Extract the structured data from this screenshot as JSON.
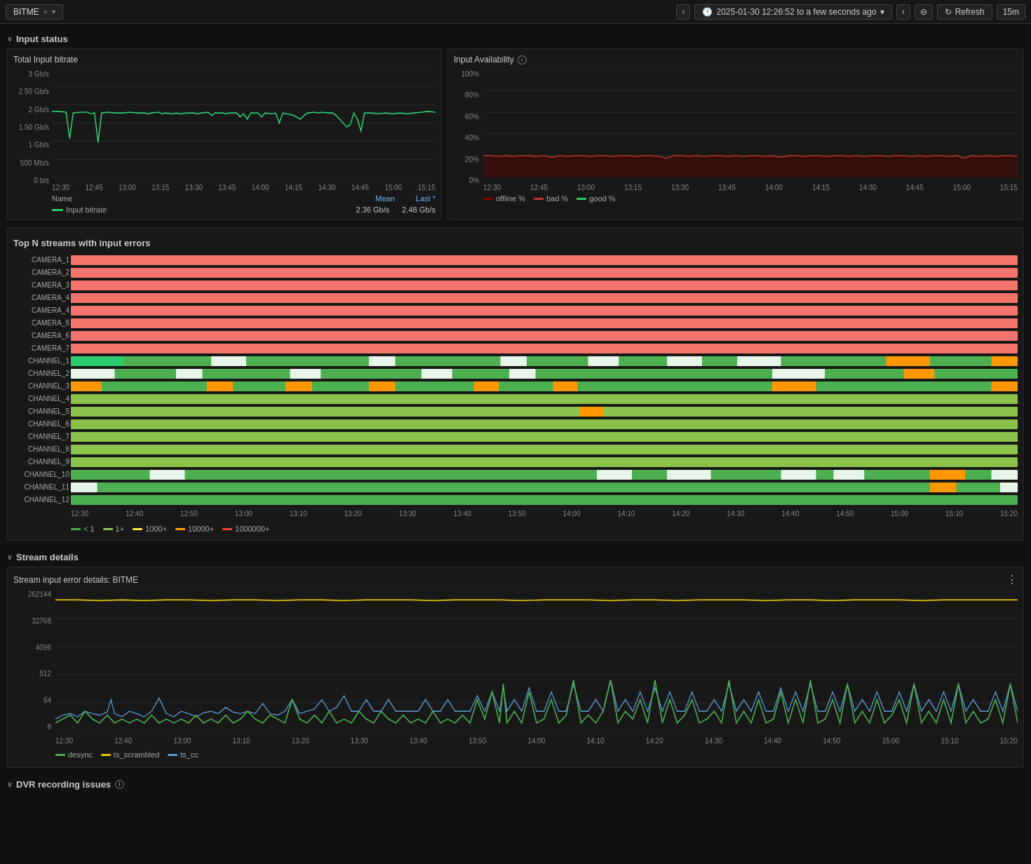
{
  "topbar": {
    "tab_label": "BITME",
    "tab_close": "×",
    "nav_prev": "‹",
    "nav_next": "›",
    "time_icon": "🕐",
    "time_range": "2025-01-30 12:26:52 to a few seconds ago",
    "zoom_icon": "⊖",
    "refresh_label": "Refresh",
    "interval_label": "15m",
    "chevron": "∨"
  },
  "input_status": {
    "section_label": "Input status",
    "chevron": "∨",
    "bitrate_panel": {
      "title": "Total Input bitrate",
      "y_labels": [
        "3 Gb/s",
        "2.50 Gb/s",
        "2 Gb/s",
        "1.50 Gb/s",
        "1 Gb/s",
        "500 Mb/s",
        "0 b/s"
      ],
      "x_labels": [
        "12:30",
        "12:45",
        "13:00",
        "13:15",
        "13:30",
        "13:45",
        "14:00",
        "14:15",
        "14:30",
        "14:45",
        "15:00",
        "15:15"
      ],
      "legend_name_label": "Name",
      "legend_mean_label": "Mean",
      "legend_last_label": "Last *",
      "legend_item": "Input bitrate",
      "mean_value": "2.36 Gb/s",
      "last_value": "2.48 Gb/s"
    },
    "avail_panel": {
      "title": "Input Availability",
      "y_labels": [
        "100%",
        "80%",
        "60%",
        "40%",
        "20%",
        "0%"
      ],
      "x_labels": [
        "12:30",
        "12:45",
        "13:00",
        "13:15",
        "13:30",
        "13:45",
        "14:00",
        "14:15",
        "14:30",
        "14:45",
        "15:00",
        "15:15"
      ],
      "legend_offline": "offline %",
      "legend_bad": "bad %",
      "legend_good": "good %"
    }
  },
  "top_n_streams": {
    "section_label": "Top N streams with input errors",
    "x_labels": [
      "12:30",
      "12:40",
      "12:50",
      "13:00",
      "13:10",
      "13:20",
      "13:30",
      "13:40",
      "13:50",
      "14:00",
      "14:10",
      "14:20",
      "14:30",
      "14:40",
      "14:50",
      "15:00",
      "15:10",
      "15:20"
    ],
    "streams": [
      "CAMERA_1",
      "CAMERA_2",
      "CAMERA_3",
      "CAMERA_4",
      "CAMERA_4",
      "CAMERA_5",
      "CAMERA_6",
      "CAMERA_7",
      "CHANNEL_1",
      "CHANNEL_2",
      "CHANNEL_3",
      "CHANNEL_4",
      "CHANNEL_5",
      "CHANNEL_6",
      "CHANNEL_7",
      "CHANNEL_8",
      "CHANNEL_9",
      "CHANNEL_10",
      "CHANNEL_11",
      "CHANNEL_12"
    ],
    "legend": [
      {
        "color": "#4caf50",
        "label": "< 1"
      },
      {
        "color": "#8bc34a",
        "label": "1+"
      },
      {
        "color": "#ffeb3b",
        "label": "1000+"
      },
      {
        "color": "#ff9800",
        "label": "10000+"
      },
      {
        "color": "#f44336",
        "label": "1000000+"
      }
    ]
  },
  "stream_details": {
    "section_label": "Stream details",
    "chevron": "∨",
    "chart_title": "Stream input error details: BITME",
    "y_labels": [
      "262144",
      "32768",
      "4096",
      "512",
      "64",
      "8"
    ],
    "x_labels": [
      "12:30",
      "12:40",
      "13:00",
      "13:10",
      "13:20",
      "13:30",
      "13:40",
      "13:50",
      "14:00",
      "14:10",
      "14:20",
      "14:30",
      "14:40",
      "14:50",
      "15:00",
      "15:10",
      "15:20"
    ],
    "legend": [
      {
        "color": "#4caf50",
        "label": "desync"
      },
      {
        "color": "#ffeb3b",
        "label": "ts_scrambled"
      },
      {
        "color": "#2196f3",
        "label": "ts_cc"
      }
    ],
    "menu_icon": "⋮"
  },
  "dvr_recording": {
    "section_label": "DVR recording issues",
    "info_icon": "i"
  }
}
